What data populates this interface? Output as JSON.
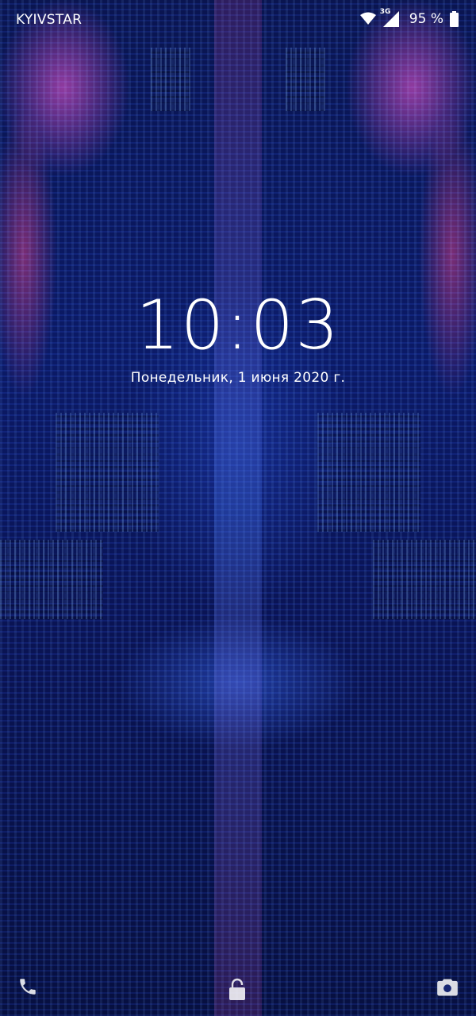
{
  "status_bar": {
    "carrier": "KYIVSTAR",
    "network_type": "3G",
    "battery_percent": "95 %",
    "icons": [
      "wifi-icon",
      "mobile-signal-icon",
      "battery-icon"
    ]
  },
  "lockscreen": {
    "time": "10:03",
    "date": "Понедельник, 1 июня 2020 г."
  },
  "bottom_shortcuts": {
    "left": "phone-icon",
    "center": "lock-icon",
    "right": "camera-icon"
  },
  "colors": {
    "text": "#ffffff",
    "wallpaper_base": "#0b1a66",
    "wallpaper_accent": "#ff5adc"
  }
}
